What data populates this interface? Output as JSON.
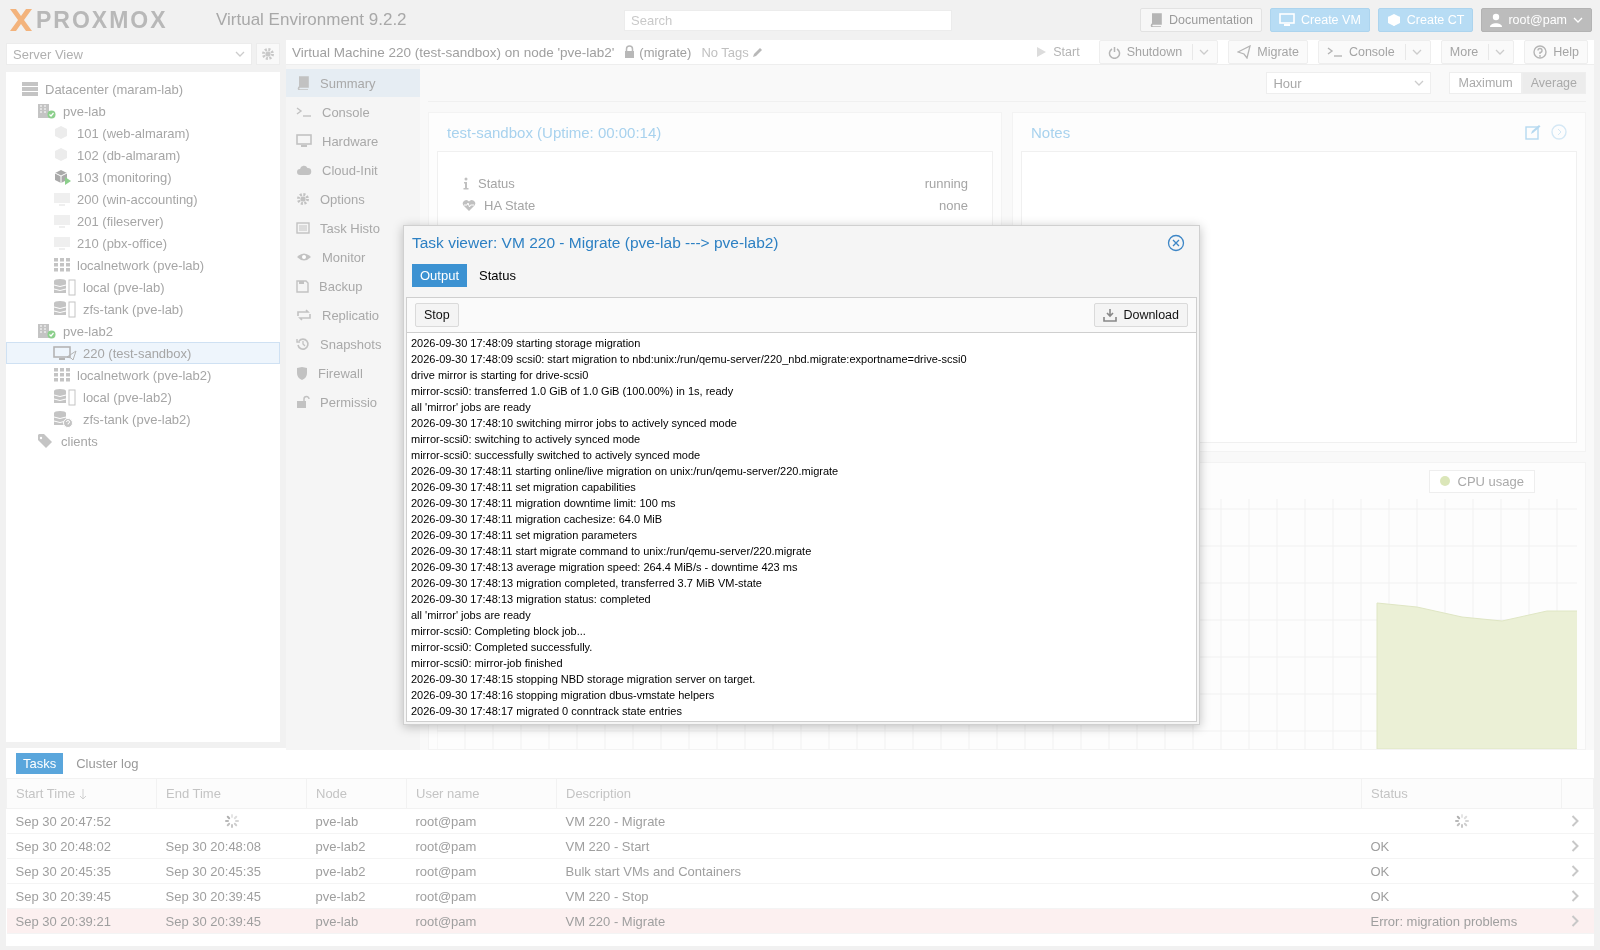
{
  "topbar": {
    "logo": "PROXMOX",
    "product": "Virtual Environment 9.2.2",
    "search": {
      "placeholder": "Search"
    },
    "buttons": [
      {
        "label": "Documentation",
        "kind": "plain"
      },
      {
        "label": "Create VM",
        "kind": "primary"
      },
      {
        "label": "Create CT",
        "kind": "primary"
      },
      {
        "label": "root@pam",
        "kind": "user"
      }
    ]
  },
  "sidebar": {
    "view": "Server View",
    "tree": [
      {
        "label": "Datacenter (maram-lab)",
        "kind": "datacenter",
        "selected": false,
        "children": [
          {
            "label": "pve-lab",
            "kind": "node",
            "selected": false,
            "children": [
              {
                "label": "101 (web-almaram)",
                "kind": "ct",
                "selected": false
              },
              {
                "label": "102 (db-almaram)",
                "kind": "ct",
                "selected": false
              },
              {
                "label": "103 (monitoring)",
                "kind": "ct-running",
                "selected": false
              },
              {
                "label": "200 (win-accounting)",
                "kind": "vm",
                "selected": false
              },
              {
                "label": "201 (fileserver)",
                "kind": "vm",
                "selected": false
              },
              {
                "label": "210 (pbx-office)",
                "kind": "vm",
                "selected": false
              },
              {
                "label": "localnetwork (pve-lab)",
                "kind": "sdn",
                "selected": false
              },
              {
                "label": "local (pve-lab)",
                "kind": "storage",
                "selected": false
              },
              {
                "label": "zfs-tank (pve-lab)",
                "kind": "storage",
                "selected": false
              }
            ]
          },
          {
            "label": "pve-lab2",
            "kind": "node",
            "selected": false,
            "children": [
              {
                "label": "220 (test-sandbox)",
                "kind": "vm-migrating",
                "selected": true
              },
              {
                "label": "localnetwork (pve-lab2)",
                "kind": "sdn",
                "selected": false
              },
              {
                "label": "local (pve-lab2)",
                "kind": "storage",
                "selected": false
              },
              {
                "label": "zfs-tank (pve-lab2)",
                "kind": "storage-unknown",
                "selected": false
              }
            ]
          },
          {
            "label": "clients",
            "kind": "tags",
            "selected": false
          }
        ]
      }
    ]
  },
  "vm_header": {
    "title": "Virtual Machine 220 (test-sandbox) on node 'pve-lab2'",
    "lock": "(migrate)",
    "tags": "No Tags",
    "buttons": [
      {
        "label": "Start",
        "disabled": true,
        "split": false
      },
      {
        "label": "Shutdown",
        "disabled": false,
        "split": true
      },
      {
        "label": "Migrate",
        "disabled": false,
        "split": false
      },
      {
        "label": "Console",
        "disabled": false,
        "split": true
      },
      {
        "label": "More",
        "disabled": false,
        "split": true
      },
      {
        "label": "Help",
        "disabled": false,
        "split": false
      }
    ]
  },
  "nav": [
    {
      "label": "Summary",
      "selected": true
    },
    {
      "label": "Console",
      "selected": false
    },
    {
      "label": "Hardware",
      "selected": false
    },
    {
      "label": "Cloud-Init",
      "selected": false
    },
    {
      "label": "Options",
      "selected": false
    },
    {
      "label": "Task Histo",
      "selected": false
    },
    {
      "label": "Monitor",
      "selected": false
    },
    {
      "label": "Backup",
      "selected": false
    },
    {
      "label": "Replicatio",
      "selected": false
    },
    {
      "label": "Snapshots",
      "selected": false
    },
    {
      "label": "Firewall",
      "selected": false
    },
    {
      "label": "Permissio",
      "selected": false
    }
  ],
  "toolbar": {
    "timeframe": "Hour",
    "modes": [
      {
        "label": "Maximum",
        "selected": false
      },
      {
        "label": "Average",
        "selected": true
      }
    ]
  },
  "summary": {
    "title": "test-sandbox (Uptime: 00:00:14)",
    "rows": [
      {
        "label": "Status",
        "value": "running"
      },
      {
        "label": "HA State",
        "value": "none"
      }
    ]
  },
  "notes": {
    "title": "Notes"
  },
  "cpu_chart": {
    "legend": "CPU usage"
  },
  "task_viewer": {
    "title": "Task viewer: VM 220 - Migrate (pve-lab ---> pve-lab2)",
    "tabs": [
      {
        "label": "Output",
        "selected": true
      },
      {
        "label": "Status",
        "selected": false
      }
    ],
    "stop": "Stop",
    "download": "Download",
    "log": [
      "2026-09-30 17:48:09 starting storage migration",
      "2026-09-30 17:48:09 scsi0: start migration to nbd:unix:/run/qemu-server/220_nbd.migrate:exportname=drive-scsi0",
      "drive mirror is starting for drive-scsi0",
      "mirror-scsi0: transferred 1.0 GiB of 1.0 GiB (100.00%) in 1s, ready",
      "all 'mirror' jobs are ready",
      "2026-09-30 17:48:10 switching mirror jobs to actively synced mode",
      "mirror-scsi0: switching to actively synced mode",
      "mirror-scsi0: successfully switched to actively synced mode",
      "2026-09-30 17:48:11 starting online/live migration on unix:/run/qemu-server/220.migrate",
      "2026-09-30 17:48:11 set migration capabilities",
      "2026-09-30 17:48:11 migration downtime limit: 100 ms",
      "2026-09-30 17:48:11 migration cachesize: 64.0 MiB",
      "2026-09-30 17:48:11 set migration parameters",
      "2026-09-30 17:48:11 start migrate command to unix:/run/qemu-server/220.migrate",
      "2026-09-30 17:48:13 average migration speed: 264.4 MiB/s - downtime 423 ms",
      "2026-09-30 17:48:13 migration completed, transferred 3.7 MiB VM-state",
      "2026-09-30 17:48:13 migration status: completed",
      "all 'mirror' jobs are ready",
      "mirror-scsi0: Completing block job...",
      "mirror-scsi0: Completed successfully.",
      "mirror-scsi0: mirror-job finished",
      "2026-09-30 17:48:15 stopping NBD storage migration server on target.",
      "2026-09-30 17:48:16 stopping migration dbus-vmstate helpers",
      "2026-09-30 17:48:17 migrated 0 conntrack state entries"
    ]
  },
  "log_panel": {
    "tabs": [
      {
        "label": "Tasks",
        "selected": true
      },
      {
        "label": "Cluster log",
        "selected": false
      }
    ],
    "columns": [
      "Start Time",
      "End Time",
      "Node",
      "User name",
      "Description",
      "Status"
    ],
    "rows": [
      {
        "start": "Sep 30 20:47:52",
        "end": "",
        "node": "pve-lab",
        "user": "root@pam",
        "description": "VM 220 - Migrate",
        "status": "",
        "running": true,
        "error": false
      },
      {
        "start": "Sep 30 20:48:02",
        "end": "Sep 30 20:48:08",
        "node": "pve-lab2",
        "user": "root@pam",
        "description": "VM 220 - Start",
        "status": "OK",
        "running": false,
        "error": false
      },
      {
        "start": "Sep 30 20:45:35",
        "end": "Sep 30 20:45:35",
        "node": "pve-lab2",
        "user": "root@pam",
        "description": "Bulk start VMs and Containers",
        "status": "OK",
        "running": false,
        "error": false
      },
      {
        "start": "Sep 30 20:39:45",
        "end": "Sep 30 20:39:45",
        "node": "pve-lab2",
        "user": "root@pam",
        "description": "VM 220 - Stop",
        "status": "OK",
        "running": false,
        "error": false
      },
      {
        "start": "Sep 30 20:39:21",
        "end": "Sep 30 20:39:45",
        "node": "pve-lab",
        "user": "root@pam",
        "description": "VM 220 - Migrate",
        "status": "Error: migration problems",
        "running": false,
        "error": true
      }
    ]
  }
}
